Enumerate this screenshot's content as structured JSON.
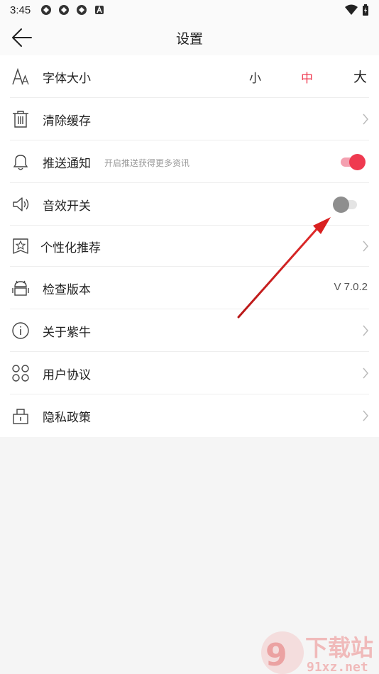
{
  "status_bar": {
    "time": "3:45"
  },
  "header": {
    "title": "设置"
  },
  "colors": {
    "accent": "#ef3a50",
    "toggle_on_track": "#f4a0b0",
    "toggle_off_knob": "#8e8e8e",
    "toggle_off_track": "#e4e4e4",
    "annotation_arrow": "#d92020"
  },
  "settings": {
    "font_size": {
      "label": "字体大小",
      "options": [
        "小",
        "中",
        "大"
      ],
      "selected": "中"
    },
    "clear_cache": {
      "label": "清除缓存"
    },
    "push": {
      "label": "推送通知",
      "hint": "开启推送获得更多资讯",
      "enabled": true
    },
    "sound": {
      "label": "音效开关",
      "enabled": false
    },
    "personalized": {
      "label": "个性化推荐"
    },
    "check_version": {
      "label": "检查版本",
      "value": "V 7.0.2"
    },
    "about": {
      "label": "关于紫牛"
    },
    "agreement": {
      "label": "用户协议"
    },
    "privacy": {
      "label": "隐私政策"
    }
  },
  "watermark": {
    "text": "下载站",
    "site": "91xz.net"
  }
}
